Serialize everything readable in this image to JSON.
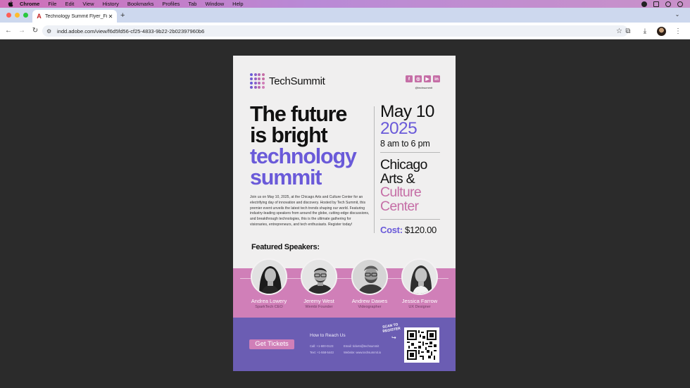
{
  "menubar": {
    "app": "Chrome",
    "items": [
      "File",
      "Edit",
      "View",
      "History",
      "Bookmarks",
      "Profiles",
      "Tab",
      "Window",
      "Help"
    ]
  },
  "browser": {
    "tab_title": "Technology Summit Flyer_Fin",
    "tab_close": "✕",
    "new_tab": "+",
    "url": "indd.adobe.com/view/f6d5fd56-cf25-4833-9b22-2b02397960b6"
  },
  "flyer": {
    "brand": "TechSummit",
    "handle": "@techsummit",
    "headline_dark": [
      "The future",
      "is bright"
    ],
    "headline_violet": [
      "technology",
      "summit"
    ],
    "date_md": "May 10",
    "date_year": "2025",
    "time": "8 am to 6 pm",
    "venue_dark": [
      "Chicago",
      "Arts &"
    ],
    "venue_pink": [
      "Culture",
      "Center"
    ],
    "cost_label": "Cost:",
    "cost_value": "$120.00",
    "blurb": "Join us on May 10, 2025, at the Chicago Arts and Culture Center for an electrifying day of innovation and discovery. Hosted by Tech Summit, this premier event unveils the latest tech trends shaping our world. Featuring industry-leading speakers from around the globe, cutting-edge discussions, and breakthrough technologies, this is the ultimate gathering for visionaries, entrepreneurs, and tech enthusiasts. Register today!",
    "speakers_title": "Featured Speakers:",
    "speakers": [
      {
        "name": "Andrea Lowery",
        "role": "SparkTech CEO"
      },
      {
        "name": "Jeremy West",
        "role": "Wembi Founder"
      },
      {
        "name": "Andrew Dawes",
        "role": "Videographer"
      },
      {
        "name": "Jessica Farrow",
        "role": "UX Designer"
      }
    ],
    "cta": "Get Tickets",
    "reach_title": "How to Reach Us",
    "call": "Call: +1-600-0123",
    "text": "Text: +1-558-5443",
    "email": "Email: tickets@techsummit",
    "website": "Website: www.techsummit.io",
    "scan_note": "SCAN TO REGISTER"
  },
  "colors": {
    "violet": "#6a5ad9",
    "pink": "#d07fb8",
    "footer": "#6b5db3"
  }
}
